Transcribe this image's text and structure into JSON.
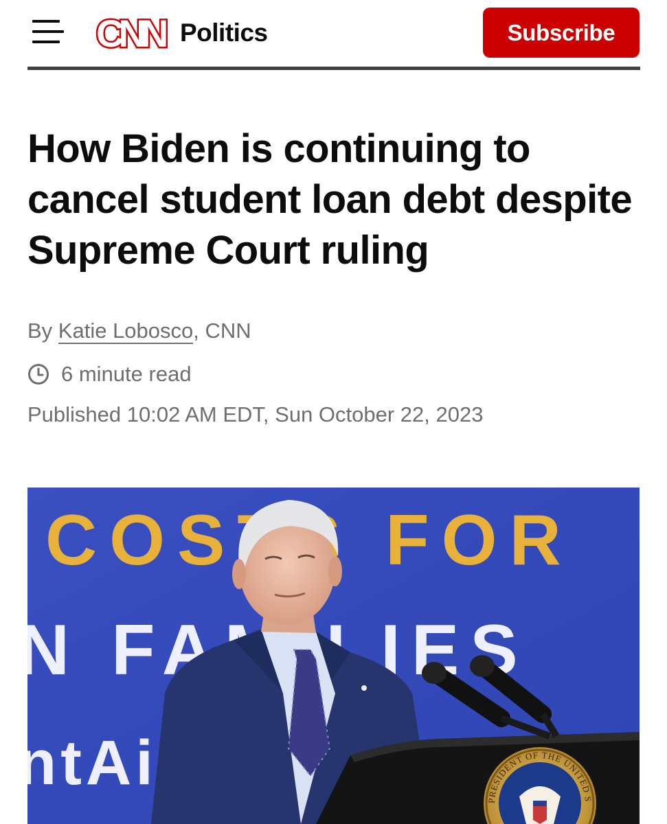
{
  "header": {
    "logo_text": "CNN",
    "section": "Politics",
    "subscribe_label": "Subscribe"
  },
  "article": {
    "headline": "How Biden is continuing to cancel student loan debt despite Supreme Court ruling",
    "byline_prefix": "By ",
    "author": "Katie Lobosco",
    "byline_suffix": ", CNN",
    "read_time": "6 minute read",
    "published": "Published 10:02 AM EDT, Sun October 22, 2023"
  },
  "photo": {
    "backdrop_line1": "COSTS FOR",
    "backdrop_line2": "N FAMILIES",
    "backdrop_line3": "ntAi",
    "seal_text": "PRESIDENT OF THE UNITED STATES"
  },
  "colors": {
    "brand_red": "#cc0000",
    "text": "#0c0c0c",
    "meta_gray": "#6e6e6e",
    "backdrop_blue": "#3b50c2",
    "backdrop_gold": "#e8b23a"
  },
  "icons": {
    "menu": "hamburger-menu-icon",
    "clock": "clock-icon"
  }
}
